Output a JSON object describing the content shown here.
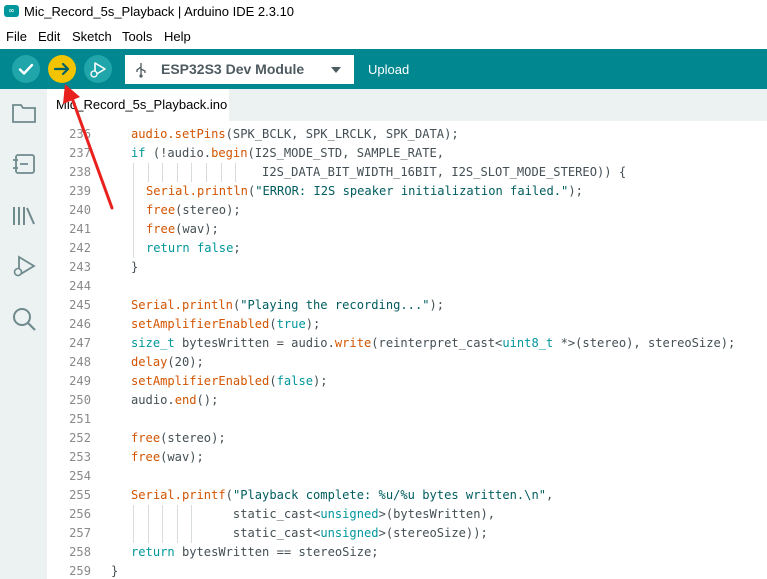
{
  "window": {
    "title": "Mic_Record_5s_Playback | Arduino IDE 2.3.10"
  },
  "menu": [
    "File",
    "Edit",
    "Sketch",
    "Tools",
    "Help"
  ],
  "toolbar": {
    "board_name": "ESP32S3 Dev Module",
    "upload_label": "Upload",
    "accent_color": "#00878f",
    "highlight_color": "#f5c400"
  },
  "tabs": [
    {
      "label": "Mic_Record_5s_Playback.ino"
    }
  ],
  "sidebar": {
    "icons": [
      "folder-icon",
      "board-manager-icon",
      "library-icon",
      "debug-icon",
      "search-icon"
    ]
  },
  "code": {
    "lines": [
      {
        "no": "236",
        "indent": 1,
        "segs": [
          [
            "fn",
            "audio.setPins"
          ],
          [
            "",
            "(SPK_BCLK, SPK_LRCLK, SPK_DATA);"
          ]
        ]
      },
      {
        "no": "237",
        "indent": 1,
        "segs": [
          [
            "kw",
            "if"
          ],
          [
            "",
            " (!audio."
          ],
          [
            "fn",
            "begin"
          ],
          [
            "",
            "(I2S_MODE_STD, SAMPLE_RATE,"
          ]
        ]
      },
      {
        "no": "238",
        "indent": 1,
        "guides": 8,
        "segs": [
          [
            "",
            "                  I2S_DATA_BIT_WIDTH_16BIT, I2S_SLOT_MODE_STEREO)) {"
          ]
        ]
      },
      {
        "no": "239",
        "indent": 2,
        "segs": [
          [
            "fn",
            "Serial.println"
          ],
          [
            "",
            "("
          ],
          [
            "str",
            "\"ERROR: I2S speaker initialization failed.\""
          ],
          [
            "",
            ");"
          ]
        ]
      },
      {
        "no": "240",
        "indent": 2,
        "segs": [
          [
            "fn",
            "free"
          ],
          [
            "",
            "(stereo);"
          ]
        ]
      },
      {
        "no": "241",
        "indent": 2,
        "segs": [
          [
            "fn",
            "free"
          ],
          [
            "",
            "(wav);"
          ]
        ]
      },
      {
        "no": "242",
        "indent": 2,
        "segs": [
          [
            "kw",
            "return"
          ],
          [
            "",
            " "
          ],
          [
            "kw",
            "false"
          ],
          [
            "",
            ";"
          ]
        ]
      },
      {
        "no": "243",
        "indent": 1,
        "segs": [
          [
            "",
            "}"
          ]
        ]
      },
      {
        "no": "244",
        "indent": 0,
        "segs": [
          [
            "",
            ""
          ]
        ]
      },
      {
        "no": "245",
        "indent": 1,
        "segs": [
          [
            "fn",
            "Serial.println"
          ],
          [
            "",
            "("
          ],
          [
            "str",
            "\"Playing the recording...\""
          ],
          [
            "",
            ");"
          ]
        ]
      },
      {
        "no": "246",
        "indent": 1,
        "segs": [
          [
            "fn",
            "setAmplifierEnabled"
          ],
          [
            "",
            "("
          ],
          [
            "kw",
            "true"
          ],
          [
            "",
            ");"
          ]
        ]
      },
      {
        "no": "247",
        "indent": 1,
        "segs": [
          [
            "ty",
            "size_t"
          ],
          [
            "",
            " bytesWritten = audio."
          ],
          [
            "fn",
            "write"
          ],
          [
            "",
            "(reinterpret_cast<"
          ],
          [
            "ty",
            "uint8_t"
          ],
          [
            "",
            " *>(stereo), stereoSize);"
          ]
        ]
      },
      {
        "no": "248",
        "indent": 1,
        "segs": [
          [
            "fn",
            "delay"
          ],
          [
            "",
            "(20);"
          ]
        ]
      },
      {
        "no": "249",
        "indent": 1,
        "segs": [
          [
            "fn",
            "setAmplifierEnabled"
          ],
          [
            "",
            "("
          ],
          [
            "kw",
            "false"
          ],
          [
            "",
            ");"
          ]
        ]
      },
      {
        "no": "250",
        "indent": 1,
        "segs": [
          [
            "",
            "audio."
          ],
          [
            "fn",
            "end"
          ],
          [
            "",
            "();"
          ]
        ]
      },
      {
        "no": "251",
        "indent": 0,
        "segs": [
          [
            "",
            ""
          ]
        ]
      },
      {
        "no": "252",
        "indent": 1,
        "segs": [
          [
            "fn",
            "free"
          ],
          [
            "",
            "(stereo);"
          ]
        ]
      },
      {
        "no": "253",
        "indent": 1,
        "segs": [
          [
            "fn",
            "free"
          ],
          [
            "",
            "(wav);"
          ]
        ]
      },
      {
        "no": "254",
        "indent": 0,
        "segs": [
          [
            "",
            ""
          ]
        ]
      },
      {
        "no": "255",
        "indent": 1,
        "segs": [
          [
            "fn",
            "Serial.printf"
          ],
          [
            "",
            "("
          ],
          [
            "str",
            "\"Playback complete: %u/%u bytes written.\\n\""
          ],
          [
            "",
            ","
          ]
        ]
      },
      {
        "no": "256",
        "indent": 1,
        "guides": 5,
        "segs": [
          [
            "",
            "              static_cast<"
          ],
          [
            "ty",
            "unsigned"
          ],
          [
            "",
            ">(bytesWritten),"
          ]
        ]
      },
      {
        "no": "257",
        "indent": 1,
        "guides": 5,
        "segs": [
          [
            "",
            "              static_cast<"
          ],
          [
            "ty",
            "unsigned"
          ],
          [
            "",
            ">(stereoSize));"
          ]
        ]
      },
      {
        "no": "258",
        "indent": 1,
        "segs": [
          [
            "kw",
            "return"
          ],
          [
            "",
            " bytesWritten == stereoSize;"
          ]
        ]
      },
      {
        "no": "259",
        "indent": 0,
        "segs": [
          [
            "",
            "}"
          ]
        ]
      }
    ]
  }
}
